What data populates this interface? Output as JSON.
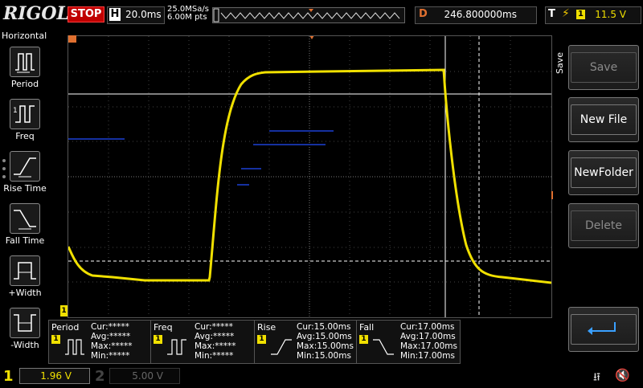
{
  "brand": {
    "name": "RIGOL"
  },
  "run_state": {
    "label": "STOP"
  },
  "timebase": {
    "key": "H",
    "value": "20.0ms"
  },
  "sample": {
    "rate": "25.0MSa/s",
    "points": "6.00M pts"
  },
  "delay": {
    "key": "D",
    "value": "246.800000ms"
  },
  "trigger": {
    "key": "T",
    "channel": "1",
    "level": "11.5 V"
  },
  "left_menu": {
    "title": "Horizontal",
    "items": [
      {
        "label": "Period",
        "icon": "period-icon"
      },
      {
        "label": "Freq",
        "icon": "freq-icon"
      },
      {
        "label": "Rise Time",
        "icon": "rise-time-icon"
      },
      {
        "label": "Fall Time",
        "icon": "fall-time-icon"
      },
      {
        "label": "+Width",
        "icon": "pos-width-icon"
      },
      {
        "label": "-Width",
        "icon": "neg-width-icon"
      }
    ]
  },
  "right_menu": {
    "title": "Save",
    "buttons": [
      {
        "label": "Save",
        "enabled": false
      },
      {
        "label": "New File",
        "enabled": true
      },
      {
        "label": "NewFolder",
        "enabled": true
      },
      {
        "label": "Delete",
        "enabled": false
      },
      {
        "label": "",
        "icon": "return-arrow-icon",
        "enabled": true
      }
    ]
  },
  "measurements": [
    {
      "title": "Period",
      "channel": "1",
      "cur": "Cur:*****",
      "avg": "Avg:*****",
      "max": "Max:*****",
      "min": "Min:*****"
    },
    {
      "title": "Freq",
      "channel": "1",
      "cur": "Cur:*****",
      "avg": "Avg:*****",
      "max": "Max:*****",
      "min": "Min:*****"
    },
    {
      "title": "Rise",
      "channel": "1",
      "cur": "Cur:15.00ms",
      "avg": "Avg:15.00ms",
      "max": "Max:15.00ms",
      "min": "Min:15.00ms"
    },
    {
      "title": "Fall",
      "channel": "1",
      "cur": "Cur:17.00ms",
      "avg": "Avg:17.00ms",
      "max": "Max:17.00ms",
      "min": "Min:17.00ms"
    }
  ],
  "channels": [
    {
      "id": "1",
      "scale": "1.96 V",
      "active": true
    },
    {
      "id": "2",
      "scale": "5.00 V",
      "active": false
    }
  ],
  "colors": {
    "ch1": "#f0e000",
    "stop": "#c00000",
    "delay": "#e07030",
    "grid": "#555555"
  }
}
